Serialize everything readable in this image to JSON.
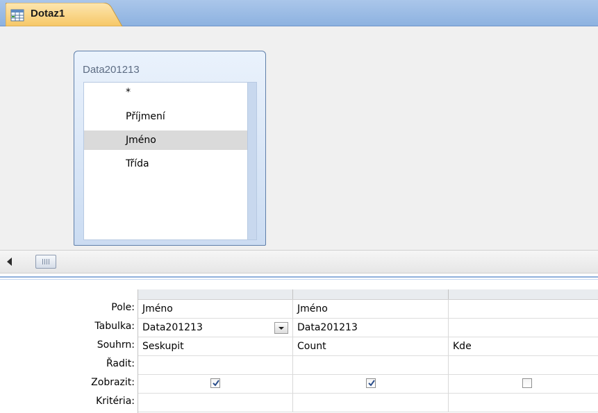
{
  "tab": {
    "title": "Dotaz1",
    "icon": "query-icon"
  },
  "table": {
    "title": "Data201213",
    "fields": [
      "*",
      "Příjmení",
      "Jméno",
      "Třída"
    ],
    "selected_index": 2
  },
  "grid": {
    "row_headers": [
      "Pole:",
      "Tabulka:",
      "Souhrn:",
      "Řadit:",
      "Zobrazit:",
      "Kritéria:"
    ],
    "columns": [
      {
        "pole": "Jméno",
        "tabulka": "Data201213",
        "souhrn": "Seskupit",
        "radit": "",
        "zobrazit": true,
        "kriteria": ""
      },
      {
        "pole": "Jméno",
        "tabulka": "Data201213",
        "souhrn": "Count",
        "radit": "",
        "zobrazit": true,
        "kriteria": ""
      },
      {
        "pole": "",
        "tabulka": "",
        "souhrn": "Kde",
        "radit": "",
        "zobrazit": false,
        "kriteria": ""
      }
    ]
  },
  "colors": {
    "tab_bar": "#8db2e0",
    "tab_fill": "#fbd88e",
    "table_border": "#5e7ea9",
    "selection": "#dadada"
  }
}
